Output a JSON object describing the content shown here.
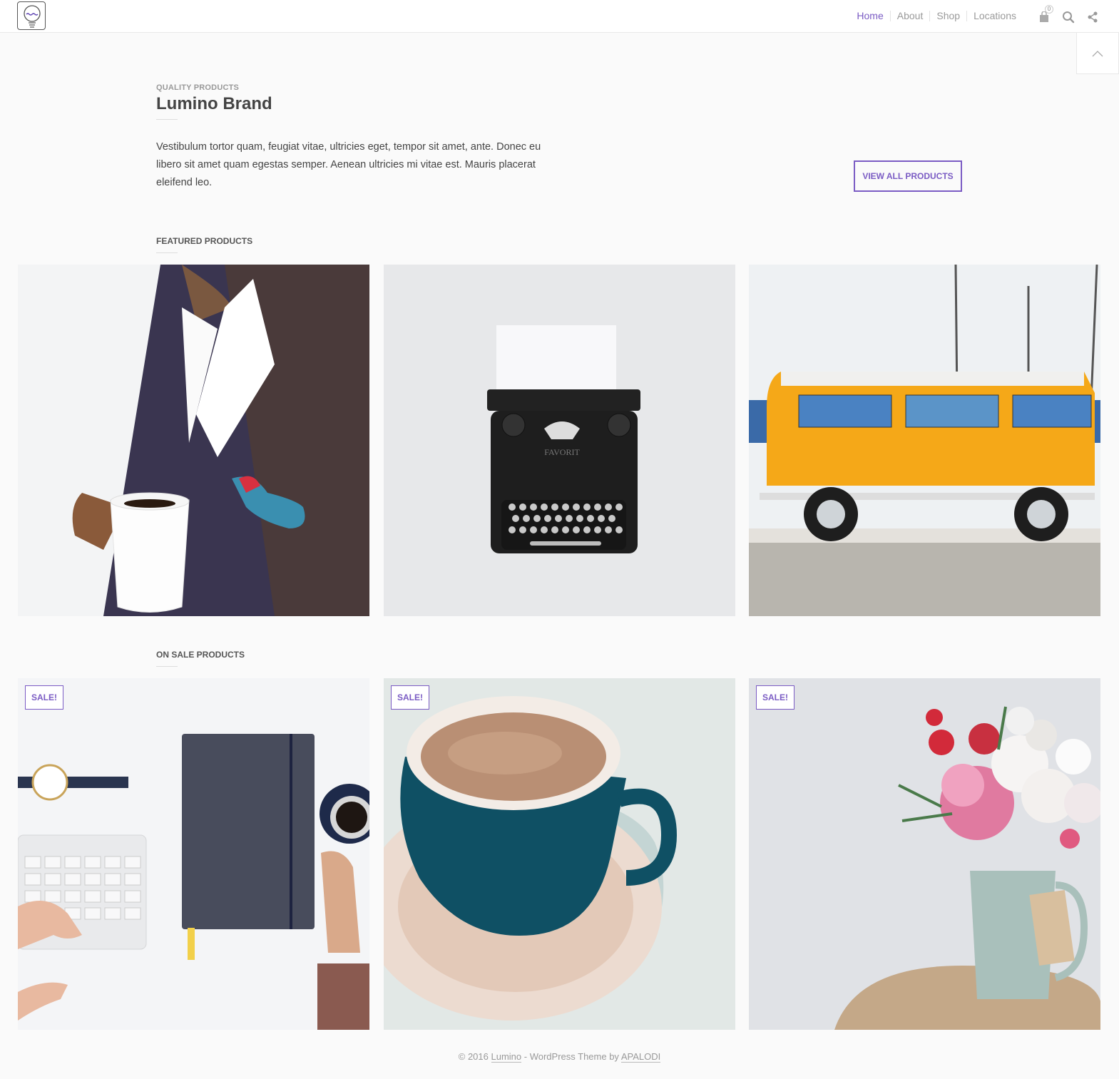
{
  "header": {
    "nav": [
      {
        "label": "Home",
        "active": true
      },
      {
        "label": "About",
        "active": false
      },
      {
        "label": "Shop",
        "active": false
      },
      {
        "label": "Locations",
        "active": false
      }
    ],
    "cart_count": "0",
    "accent_color": "#7b5cc4",
    "icons": [
      "lightbulb-logo-icon",
      "bag-icon",
      "search-icon",
      "share-icon",
      "chevron-up-icon"
    ]
  },
  "intro": {
    "eyebrow": "QUALITY PRODUCTS",
    "title": "Lumino Brand",
    "text": "Vestibulum tortor quam, feugiat vitae, ultricies eget, tempor sit amet, ante. Donec eu libero sit amet quam egestas semper. Aenean ultricies mi vitae est. Mauris placerat eleifend leo.",
    "button": "VIEW ALL PRODUCTS"
  },
  "featured": {
    "label": "FEATURED PRODUCTS"
  },
  "on_sale": {
    "label": "ON SALE PRODUCTS",
    "badge": "SALE!"
  },
  "footer": {
    "prefix": "© 2016 ",
    "site": "Lumino",
    "middle": " - WordPress Theme by ",
    "author": "APALODI"
  }
}
